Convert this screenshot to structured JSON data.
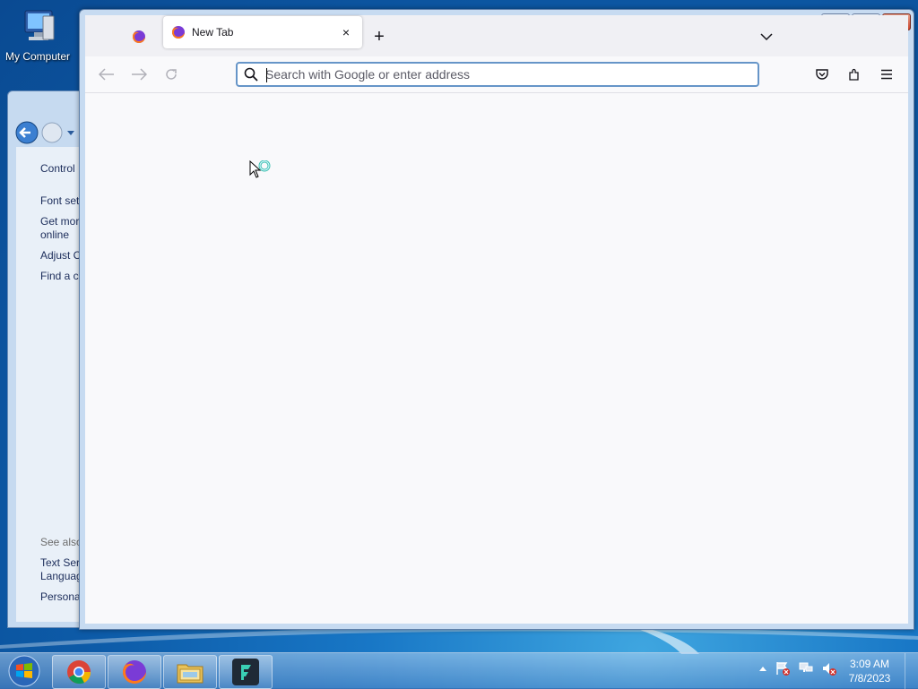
{
  "desktop": {
    "icons": [
      {
        "label": "My Computer",
        "icon": "computer-icon"
      }
    ]
  },
  "control_panel": {
    "links": [
      {
        "label": "Control"
      },
      {
        "label": "Font set"
      },
      {
        "label": "Get mor online"
      },
      {
        "label": "Adjust C"
      },
      {
        "label": "Find a c"
      }
    ],
    "see_also_label": "See also",
    "see_also_links": [
      {
        "label": "Text Ser Languag"
      },
      {
        "label": "Persona"
      }
    ]
  },
  "browser": {
    "tabs": [
      {
        "title": "",
        "icon": "firefox-icon",
        "pinned": true
      },
      {
        "title": "New Tab",
        "icon": "firefox-icon",
        "active": true
      }
    ],
    "new_tab_label": "+",
    "close_tab_label": "×",
    "url_placeholder": "Search with Google or enter address",
    "url_value": "",
    "toolbar_icons": [
      "back-icon",
      "forward-icon",
      "reload-icon",
      "pocket-icon",
      "extensions-icon",
      "menu-icon"
    ]
  },
  "taskbar": {
    "apps": [
      "chrome-icon",
      "firefox-icon",
      "file-explorer-icon",
      "filmora-icon"
    ],
    "clock": {
      "time": "3:09 AM",
      "date": "7/8/2023"
    }
  }
}
